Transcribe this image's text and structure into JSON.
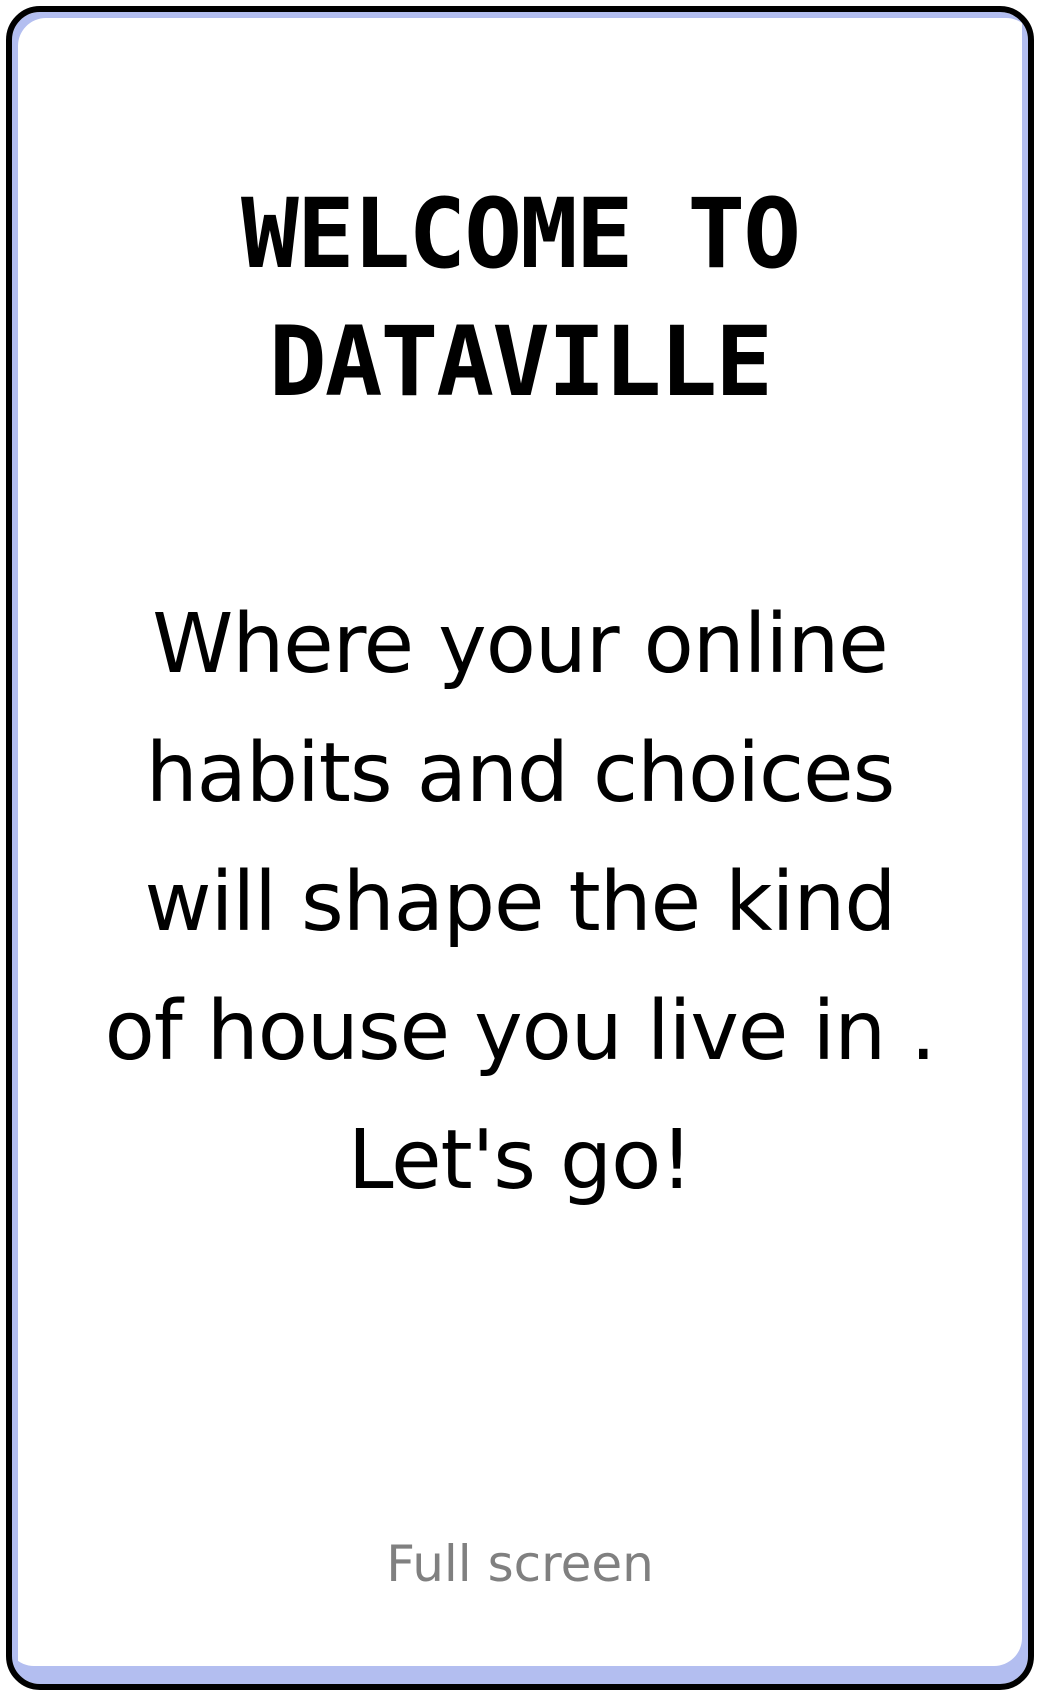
{
  "title": {
    "line1": "WELCOME TO",
    "line2": "DATAVILLE"
  },
  "intro": {
    "line1": "Where your online",
    "line2": "habits and choices",
    "line3": "will shape the kind",
    "line4": "of house you live in .",
    "line5": "Let's go!"
  },
  "controls": {
    "fullscreen_label": "Full screen"
  },
  "colors": {
    "border": "#000000",
    "border_accent": "#b3bef0",
    "background": "#ffffff",
    "text": "#000000",
    "muted_text": "#808080"
  }
}
